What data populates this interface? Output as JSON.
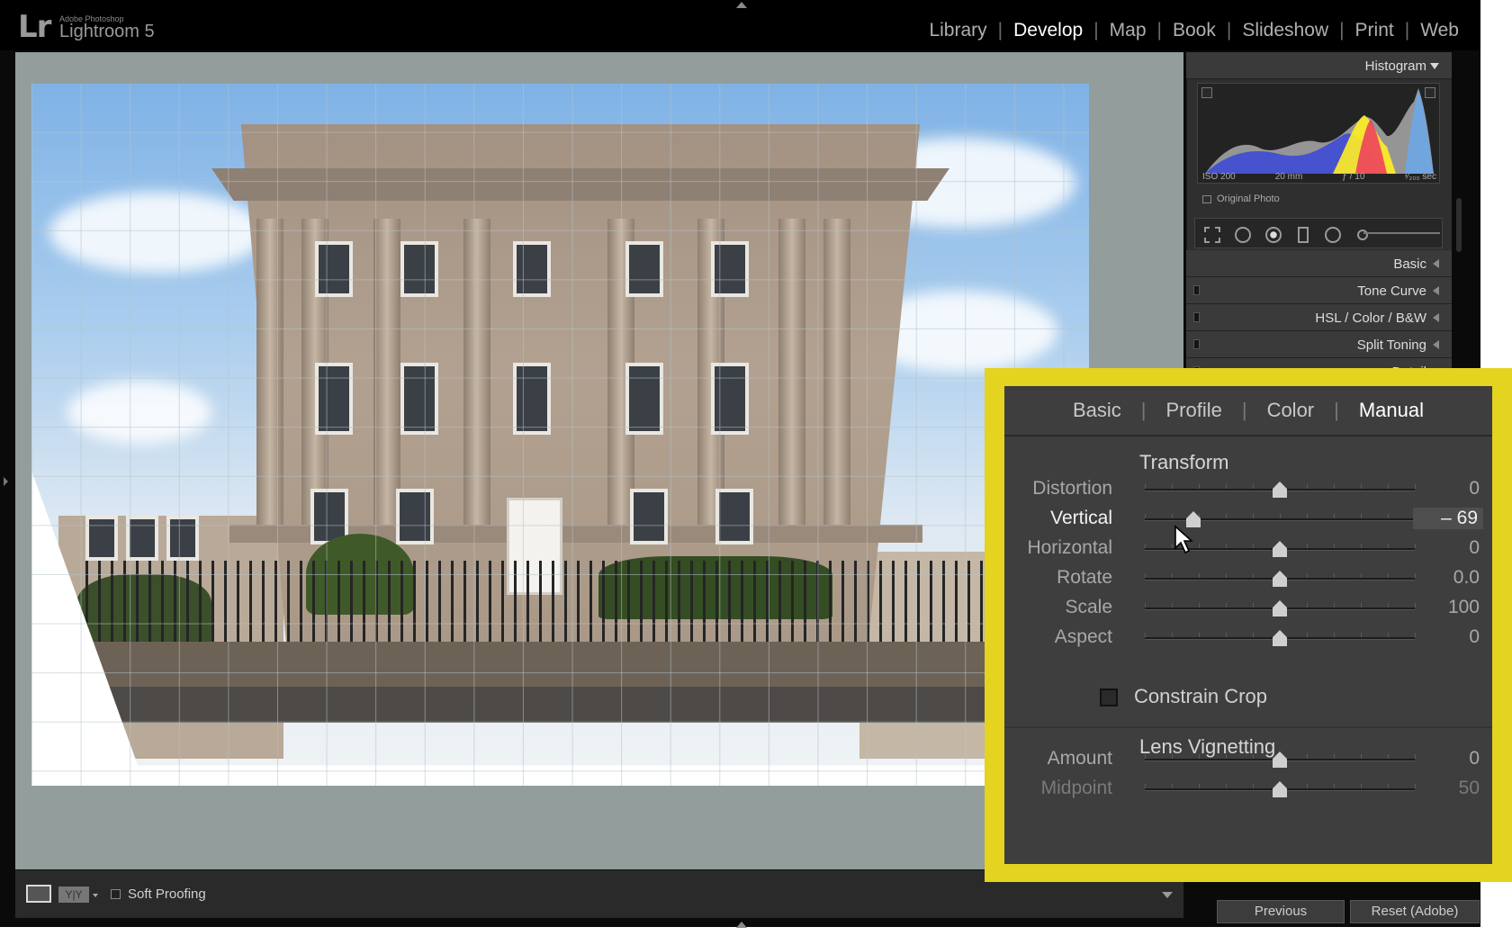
{
  "app": {
    "logo": "Lr",
    "brand_small": "Adobe Photoshop",
    "brand_name": "Lightroom 5"
  },
  "modules": [
    {
      "label": "Library",
      "active": false
    },
    {
      "label": "Develop",
      "active": true
    },
    {
      "label": "Map",
      "active": false
    },
    {
      "label": "Book",
      "active": false
    },
    {
      "label": "Slideshow",
      "active": false
    },
    {
      "label": "Print",
      "active": false
    },
    {
      "label": "Web",
      "active": false
    }
  ],
  "histogram": {
    "title": "Histogram",
    "iso": "ISO 200",
    "focal": "20 mm",
    "aperture": "ƒ / 10",
    "shutter": "¹⁄₂₀₀ sec",
    "original_photo": "Original Photo"
  },
  "panels": {
    "basic": "Basic",
    "tone_curve": "Tone Curve",
    "hsl": "HSL / Color / B&W",
    "split_toning": "Split Toning",
    "detail_partial": "Detail"
  },
  "toolbar": {
    "yy_label": "Y|Y",
    "soft_proofing": "Soft Proofing"
  },
  "buttons": {
    "previous": "Previous",
    "reset": "Reset (Adobe)"
  },
  "lens_panel": {
    "tabs": [
      {
        "label": "Basic",
        "active": false
      },
      {
        "label": "Profile",
        "active": false
      },
      {
        "label": "Color",
        "active": false
      },
      {
        "label": "Manual",
        "active": true
      }
    ],
    "transform_title": "Transform",
    "transform_sliders": [
      {
        "label": "Distortion",
        "value": "0",
        "position": 0.5,
        "active": false
      },
      {
        "label": "Vertical",
        "value": "– 69",
        "position": 0.18,
        "active": true
      },
      {
        "label": "Horizontal",
        "value": "0",
        "position": 0.5,
        "active": false
      },
      {
        "label": "Rotate",
        "value": "0.0",
        "position": 0.5,
        "active": false
      },
      {
        "label": "Scale",
        "value": "100",
        "position": 0.5,
        "active": false
      },
      {
        "label": "Aspect",
        "value": "0",
        "position": 0.5,
        "active": false
      }
    ],
    "constrain_crop": "Constrain Crop",
    "vignetting_title": "Lens Vignetting",
    "vignetting_sliders": [
      {
        "label": "Amount",
        "value": "0",
        "position": 0.5,
        "dim": false
      },
      {
        "label": "Midpoint",
        "value": "50",
        "position": 0.5,
        "dim": true
      }
    ]
  },
  "colors": {
    "callout_border": "#e4d31f",
    "panel_bg": "#3e3e3e",
    "app_bg": "#0a0a0a"
  },
  "icons": [
    "grid-overlay-icon",
    "crop-icon",
    "spot-removal-icon",
    "red-eye-icon",
    "graduated-filter-icon",
    "radial-filter-icon",
    "brush-icon",
    "cursor-arrow-icon"
  ]
}
